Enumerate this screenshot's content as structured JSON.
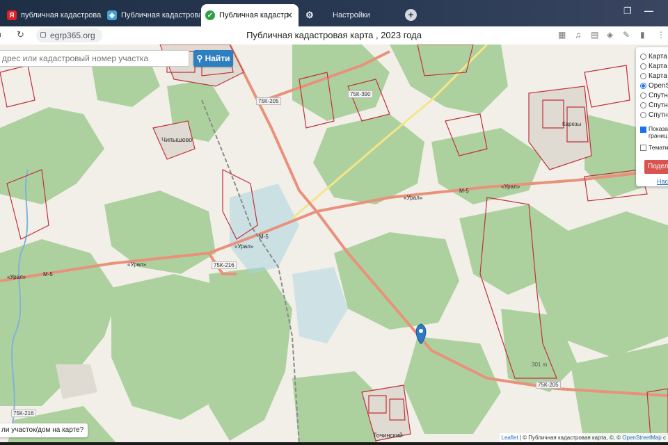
{
  "browser": {
    "tabs": [
      {
        "label": "публичная кадастровая к",
        "icon": "yandex-icon",
        "active": false
      },
      {
        "label": "Публичная кадастровая к",
        "icon": "map-site-icon",
        "active": false
      },
      {
        "label": "Публичная кадастровая",
        "icon": "check-circle-icon",
        "active": true
      }
    ],
    "settings_tab": "Настройки",
    "url": "egrp365.org",
    "page_title": "Публичная кадастровая карта , 2023 года"
  },
  "search": {
    "placeholder": "дрес или кадастровый номер участка",
    "button": "Найти"
  },
  "layers": {
    "options": [
      {
        "label": "Карта",
        "checked": false
      },
      {
        "label": "Карта",
        "checked": false
      },
      {
        "label": "Карта",
        "checked": false
      },
      {
        "label": "OpenS",
        "checked": true
      },
      {
        "label": "Спутн",
        "checked": false
      },
      {
        "label": "Спутн",
        "checked": false
      },
      {
        "label": "Спутн",
        "checked": false
      }
    ],
    "show_borders_line1": "Показа",
    "show_borders_line2": "границ",
    "show_borders_checked": true,
    "thematic": "Темати",
    "thematic_checked": false,
    "share_button": "Подел",
    "settings_link": "Наст"
  },
  "map_labels": {
    "town1": "Чипышево",
    "town2": "Точинский",
    "town3": "Карезы",
    "road_75k205_a": "75К-205",
    "road_75k205_b": "75К-205",
    "road_75k216_a": "75К-216",
    "road_75k216_b": "75К-216",
    "road_75k390": "75К-390",
    "m5_a": "М-5",
    "m5_b": "М-5",
    "m5_c": "М-5",
    "ural_a": "«Урал»",
    "ural_b": "«Урал»",
    "ural_c": "«Урал»",
    "ural_d": "«Урал»",
    "ural_e": "«Урал»",
    "km": "301 m"
  },
  "hint": "ли участок/дом на карте?",
  "attribution": {
    "leaflet": "Leaflet",
    "source": " | © Публичная кадастровая карта, ©, © ",
    "osm": "OpenStreetMap",
    "tail": " c"
  },
  "colors": {
    "map_background": "#f2efe9",
    "forest": "#add19e",
    "cadastral_border": "#c0303a",
    "trunk_road": "#e8927c",
    "primary_road": "#f5e589",
    "water": "#aad3df",
    "find_button": "#2d7fc0",
    "share_button": "#d9534f",
    "marker": "#2a7ac4"
  }
}
